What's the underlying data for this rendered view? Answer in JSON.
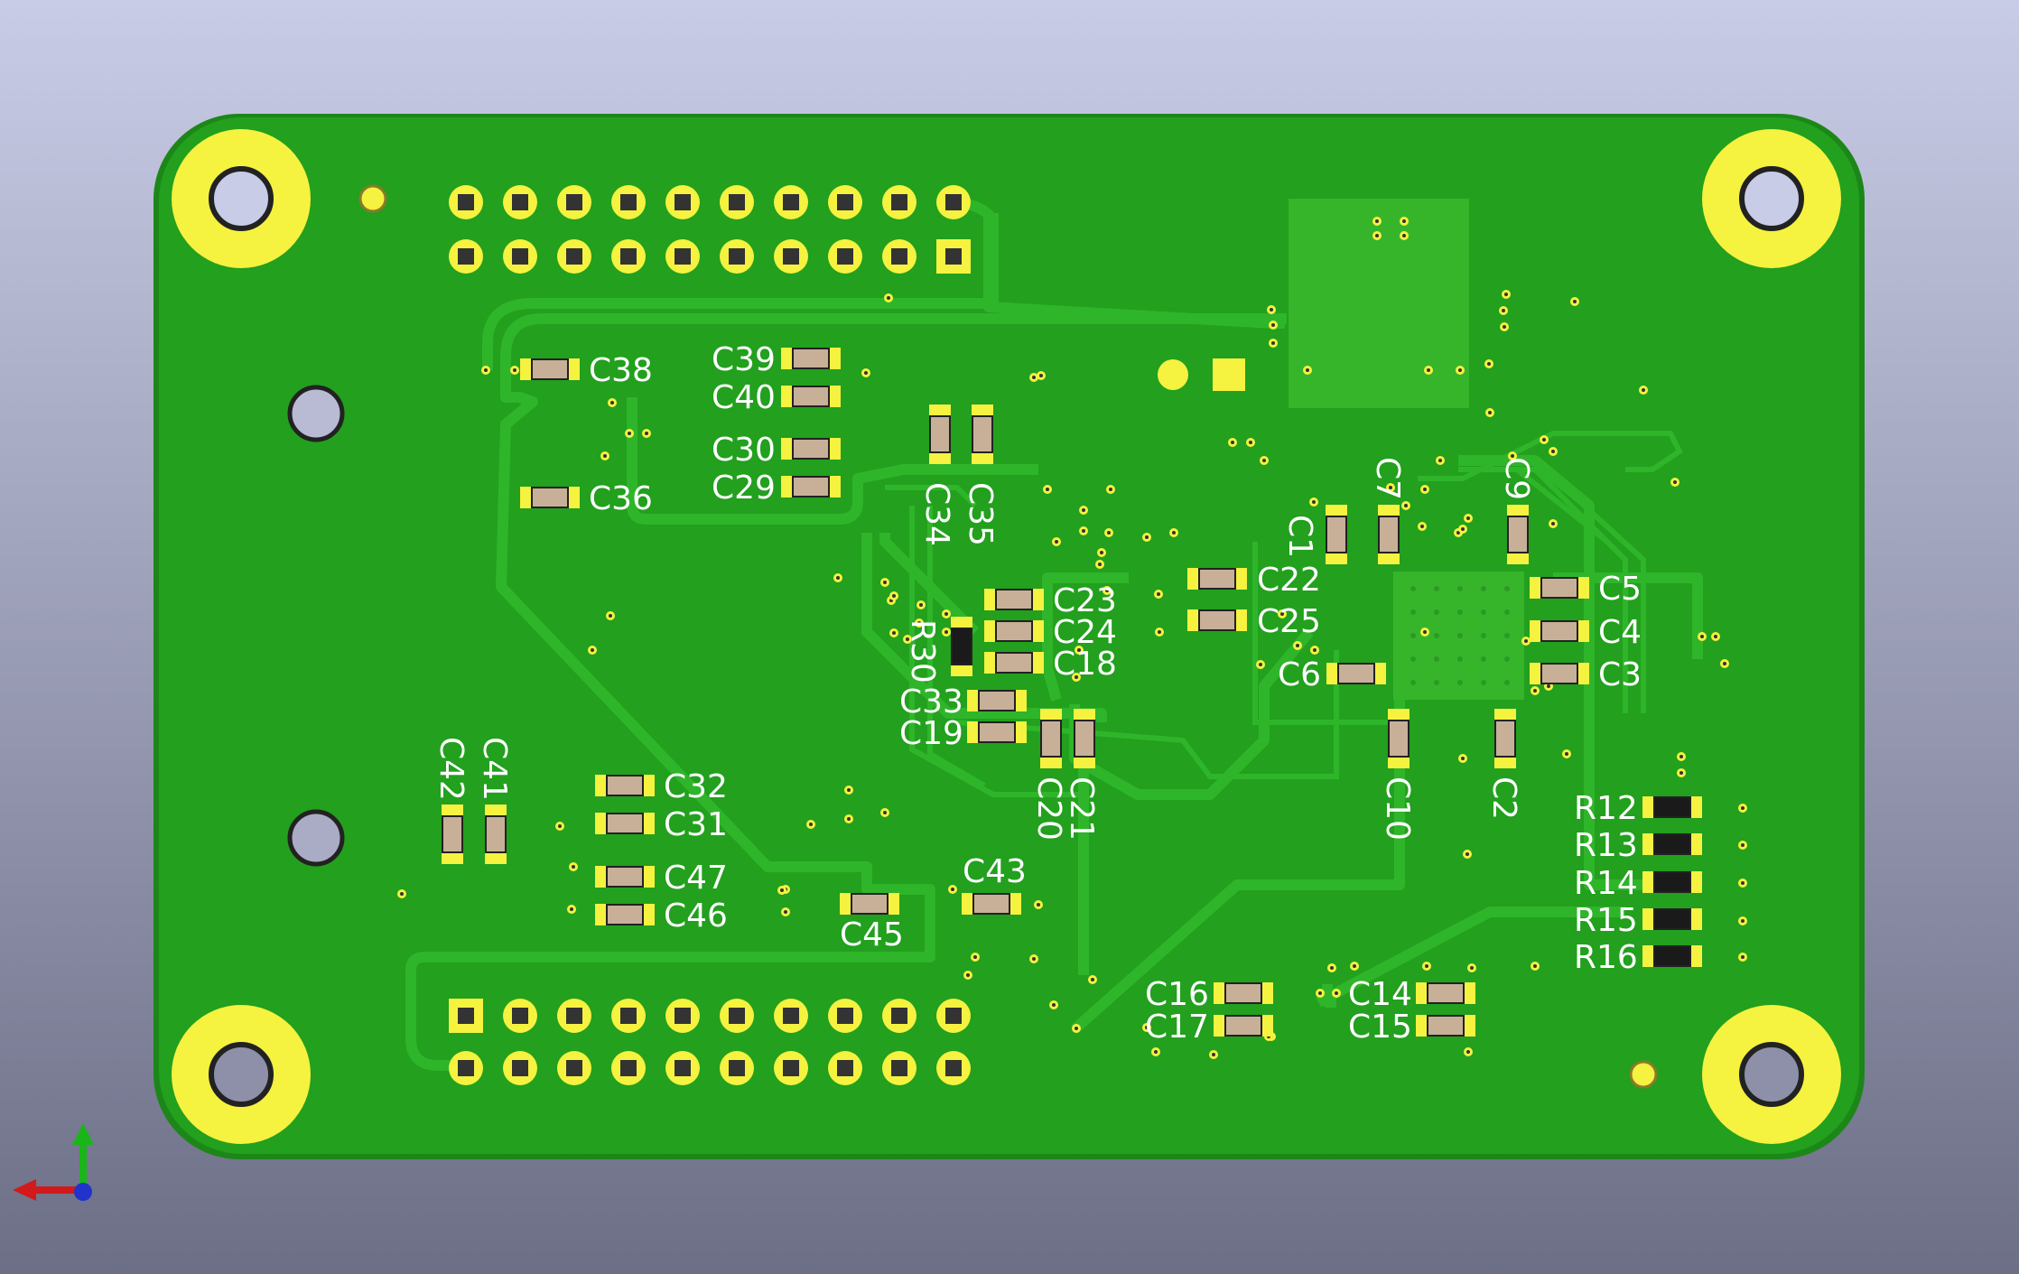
{
  "view": {
    "background_top": "#c9cce6",
    "background_bottom": "#6c6f86",
    "board_color": "#22a01e",
    "board_edge_color": "#1c8718",
    "trace_color": "#2fb52a",
    "pad_color": "#f5f240",
    "silkscreen_color": "#ffffff",
    "body_color": "#c8b098"
  },
  "components": {
    "capacitors": [
      "C38",
      "C36",
      "C39",
      "C40",
      "C30",
      "C29",
      "C34",
      "C35",
      "C23",
      "C24",
      "C18",
      "C33",
      "C19",
      "C20",
      "C21",
      "C22",
      "C25",
      "C1",
      "C7",
      "C9",
      "C5",
      "C4",
      "C3",
      "C6",
      "C10",
      "C2",
      "C42",
      "C41",
      "C32",
      "C31",
      "C47",
      "C46",
      "C45",
      "C43",
      "C16",
      "C17",
      "C14",
      "C15"
    ],
    "resistors": [
      "R30",
      "R12",
      "R13",
      "R14",
      "R15",
      "R16"
    ]
  },
  "headers": [
    {
      "name": "top-header",
      "pins": 20,
      "rows": 2
    },
    {
      "name": "bottom-header",
      "pins": 20,
      "rows": 2
    }
  ],
  "axis_icon": [
    "x-axis-arrow",
    "y-axis-arrow",
    "z-axis-dot"
  ]
}
